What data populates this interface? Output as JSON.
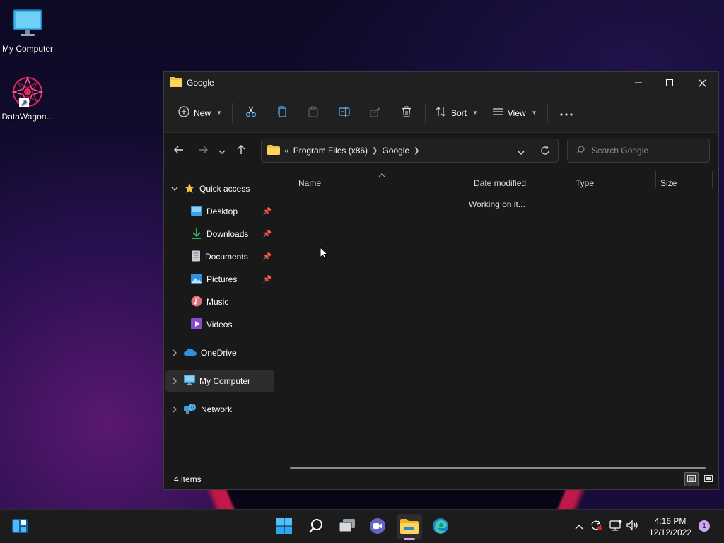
{
  "desktop": {
    "icons": [
      {
        "label": "My Computer"
      },
      {
        "label": "DataWagon..."
      }
    ]
  },
  "window": {
    "title": "Google",
    "toolbar": {
      "new_label": "New",
      "sort_label": "Sort",
      "view_label": "View"
    },
    "address": {
      "overflow": "«",
      "crumbs": [
        "Program Files (x86)",
        "Google"
      ]
    },
    "search": {
      "placeholder": "Search Google"
    },
    "sidebar": {
      "quick_access": "Quick access",
      "items": [
        {
          "label": "Desktop"
        },
        {
          "label": "Downloads"
        },
        {
          "label": "Documents"
        },
        {
          "label": "Pictures"
        },
        {
          "label": "Music"
        },
        {
          "label": "Videos"
        }
      ],
      "onedrive": "OneDrive",
      "my_computer": "My Computer",
      "network": "Network"
    },
    "columns": [
      "Name",
      "Date modified",
      "Type",
      "Size"
    ],
    "loading_text": "Working on it...",
    "status": {
      "items_count": "4 items"
    }
  },
  "taskbar": {
    "time": "4:16 PM",
    "date": "12/12/2022",
    "notification_count": "1"
  },
  "colors": {
    "accent": "#0078d4",
    "folder_yellow": "#f0c24b"
  }
}
